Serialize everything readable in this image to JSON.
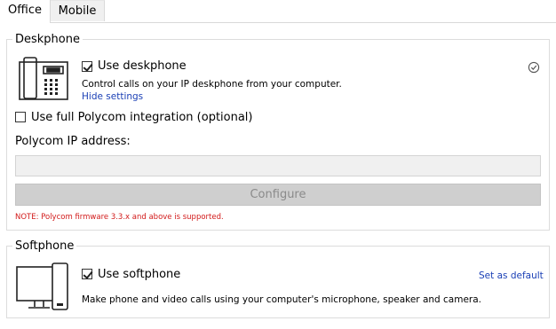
{
  "tabs": [
    {
      "label": "Office",
      "active": true
    },
    {
      "label": "Mobile",
      "active": false
    }
  ],
  "deskphone": {
    "legend": "Deskphone",
    "icon": "deskphone-icon",
    "use_label": "Use deskphone",
    "use_checked": true,
    "status_icon": "check-circle-icon",
    "description": "Control calls on your IP deskphone from your computer.",
    "hide_settings": "Hide settings",
    "polycom_label": "Use full Polycom integration (optional)",
    "polycom_checked": false,
    "ip_label": "Polycom IP address:",
    "ip_value": "",
    "configure": "Configure",
    "note": "NOTE: Polycom firmware 3.3.x and above is supported."
  },
  "softphone": {
    "legend": "Softphone",
    "icon": "computer-softphone-icon",
    "use_label": "Use softphone",
    "use_checked": true,
    "set_default": "Set as default",
    "description": "Make phone and video calls using your computer's microphone, speaker and camera."
  },
  "colors": {
    "link": "#1a3fb5",
    "note": "#d21a1a",
    "border": "#dcdcdc"
  }
}
